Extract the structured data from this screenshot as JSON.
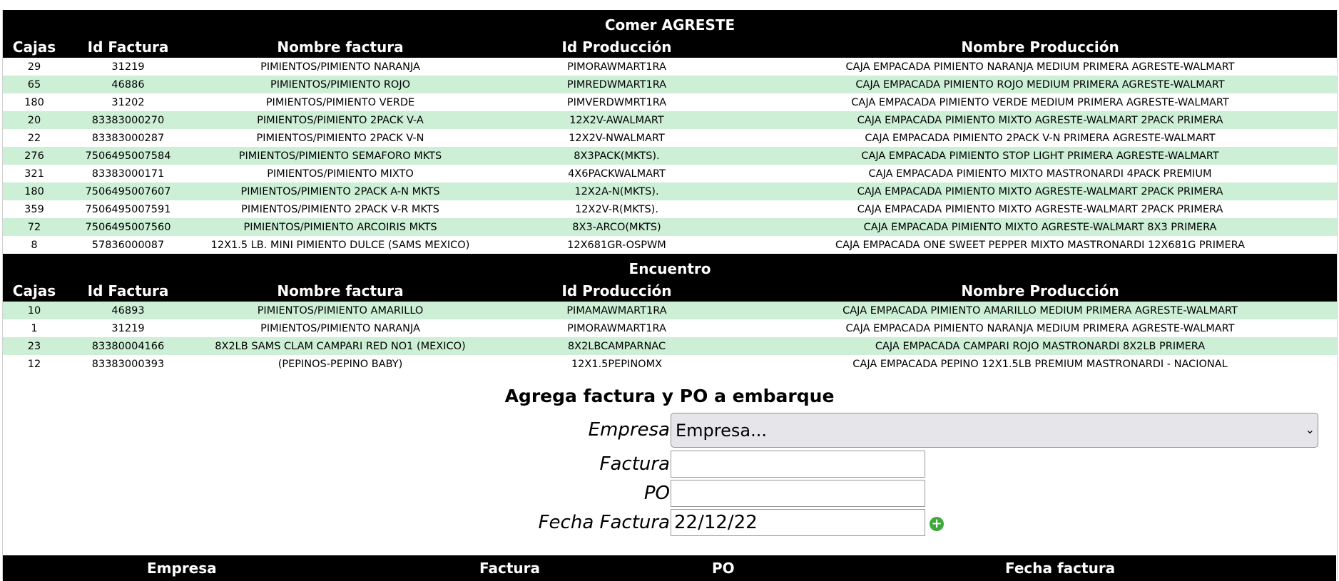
{
  "sections": [
    {
      "title": "Comer AGRESTE",
      "headers": [
        "Cajas",
        "Id Factura",
        "Nombre factura",
        "Id Producción",
        "Nombre Producción"
      ],
      "rows": [
        [
          "29",
          "31219",
          "PIMIENTOS/PIMIENTO NARANJA",
          "PIMORAWMART1RA",
          "CAJA EMPACADA PIMIENTO NARANJA MEDIUM PRIMERA AGRESTE-WALMART"
        ],
        [
          "65",
          "46886",
          "PIMIENTOS/PIMIENTO ROJO",
          "PIMREDWMART1RA",
          "CAJA EMPACADA PIMIENTO ROJO MEDIUM PRIMERA AGRESTE-WALMART"
        ],
        [
          "180",
          "31202",
          "PIMIENTOS/PIMIENTO VERDE",
          "PIMVERDWMRT1RA",
          "CAJA EMPACADA PIMIENTO VERDE MEDIUM PRIMERA AGRESTE-WALMART"
        ],
        [
          "20",
          "83383000270",
          "PIMIENTOS/PIMIENTO 2PACK V-A",
          "12X2V-AWALMART",
          "CAJA EMPACADA PIMIENTO MIXTO AGRESTE-WALMART 2PACK PRIMERA"
        ],
        [
          "22",
          "83383000287",
          "PIMIENTOS/PIMIENTO 2PACK V-N",
          "12X2V-NWALMART",
          "CAJA EMPACADA PIMIENTO 2PACK V-N PRIMERA AGRESTE-WALMART"
        ],
        [
          "276",
          "7506495007584",
          "PIMIENTOS/PIMIENTO SEMAFORO MKTS",
          "8X3PACK(MKTS).",
          "CAJA EMPACADA PIMIENTO STOP LIGHT PRIMERA AGRESTE-WALMART"
        ],
        [
          "321",
          "83383000171",
          "PIMIENTOS/PIMIENTO MIXTO",
          "4X6PACKWALMART",
          "CAJA EMPACADA PIMIENTO MIXTO MASTRONARDI 4PACK PREMIUM"
        ],
        [
          "180",
          "7506495007607",
          "PIMIENTOS/PIMIENTO 2PACK A-N MKTS",
          "12X2A-N(MKTS).",
          "CAJA EMPACADA PIMIENTO MIXTO AGRESTE-WALMART 2PACK PRIMERA"
        ],
        [
          "359",
          "7506495007591",
          "PIMIENTOS/PIMIENTO 2PACK V-R MKTS",
          "12X2V-R(MKTS).",
          "CAJA EMPACADA PIMIENTO MIXTO AGRESTE-WALMART 2PACK PRIMERA"
        ],
        [
          "72",
          "7506495007560",
          "PIMIENTOS/PIMIENTO ARCOIRIS MKTS",
          "8X3-ARCO(MKTS)",
          "CAJA EMPACADA PIMIENTO MIXTO AGRESTE-WALMART 8X3 PRIMERA"
        ],
        [
          "8",
          "57836000087",
          "12X1.5 LB. MINI PIMIENTO DULCE (SAMS MEXICO)",
          "12X681GR-OSPWM",
          "CAJA EMPACADA ONE SWEET PEPPER MIXTO MASTRONARDI 12X681G PRIMERA"
        ]
      ]
    },
    {
      "title": "Encuentro",
      "headers": [
        "Cajas",
        "Id Factura",
        "Nombre factura",
        "Id Producción",
        "Nombre Producción"
      ],
      "rows": [
        [
          "10",
          "46893",
          "PIMIENTOS/PIMIENTO AMARILLO",
          "PIMAMAWMART1RA",
          "CAJA EMPACADA PIMIENTO AMARILLO MEDIUM PRIMERA AGRESTE-WALMART"
        ],
        [
          "1",
          "31219",
          "PIMIENTOS/PIMIENTO NARANJA",
          "PIMORAWMART1RA",
          "CAJA EMPACADA PIMIENTO NARANJA MEDIUM PRIMERA AGRESTE-WALMART"
        ],
        [
          "23",
          "83380004166",
          "8X2LB SAMS CLAM CAMPARI RED NO1 (MEXICO)",
          "8X2LBCAMPARNAC",
          "CAJA EMPACADA CAMPARI ROJO MASTRONARDI 8X2LB PRIMERA"
        ],
        [
          "12",
          "83383000393",
          "(PEPINOS-PEPINO BABY)",
          "12X1.5PEPINOMX",
          "CAJA EMPACADA PEPINO 12X1.5LB PREMIUM MASTRONARDI - NACIONAL"
        ]
      ]
    }
  ],
  "form": {
    "heading": "Agrega factura y PO a embarque",
    "empresa_label": "Empresa",
    "empresa_selected": "Empresa...",
    "factura_label": "Factura",
    "factura_value": "",
    "po_label": "PO",
    "po_value": "",
    "fecha_label": "Fecha Factura",
    "fecha_value": "22/12/22",
    "add_icon": "plus-circle-icon"
  },
  "footer_headers": [
    "Empresa",
    "Factura",
    "PO",
    "Fecha factura"
  ],
  "colors": {
    "header_bg": "#000000",
    "row_alt": "#ccefd6",
    "add_icon": "#3ea83a"
  }
}
